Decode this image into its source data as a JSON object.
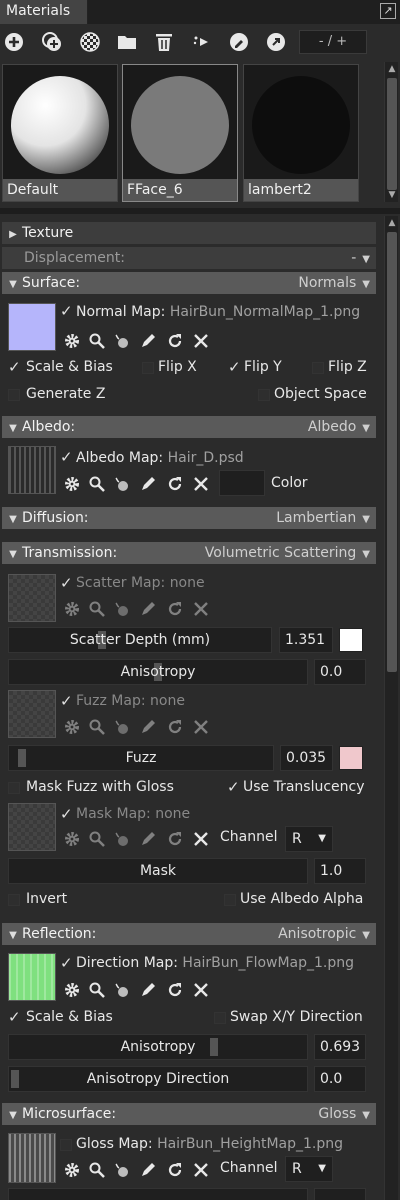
{
  "panel": {
    "tab_label": "Materials",
    "pager_text": "- / +"
  },
  "toolbar": {
    "icons": [
      "add-material-icon",
      "duplicate-material-icon",
      "checker-material-icon",
      "folder-icon",
      "delete-icon",
      "select-object-icon",
      "eyedropper-circle-icon",
      "refresh-arrow-icon"
    ]
  },
  "swatches": [
    {
      "label": "Default"
    },
    {
      "label": "FFace_6"
    },
    {
      "label": "lambert2"
    }
  ],
  "sections": {
    "texture": "Texture",
    "displacement": {
      "label": "Displacement:",
      "value": "-"
    },
    "surface": {
      "label": "Surface:",
      "value": "Normals"
    },
    "albedo": {
      "label": "Albedo:",
      "value": "Albedo"
    },
    "diffusion": {
      "label": "Diffusion:",
      "value": "Lambertian"
    },
    "transmission": {
      "label": "Transmission:",
      "value": "Volumetric Scattering"
    },
    "reflection": {
      "label": "Reflection:",
      "value": "Anisotropic"
    },
    "microsurface": {
      "label": "Microsurface:",
      "value": "Gloss"
    }
  },
  "surface": {
    "map_label": "Normal Map:",
    "map_value": "HairBun_NormalMap_1.png",
    "scale_bias": "Scale & Bias",
    "flip_x": "Flip X",
    "flip_y": "Flip Y",
    "flip_z": "Flip Z",
    "generate_z": "Generate Z",
    "object_space": "Object Space",
    "thumb_color": "#b5b5fb"
  },
  "albedo": {
    "map_label": "Albedo Map:",
    "map_value": "Hair_D.psd",
    "color_label": "Color"
  },
  "transmission": {
    "scatter_map_label": "Scatter Map:",
    "scatter_map_value": "none",
    "scatter_depth_label": "Scatter Depth (mm)",
    "scatter_depth_value": "1.351",
    "scatter_depth_fraction": 0.35,
    "anisotropy_label": "Anisotropy",
    "anisotropy_value": "0.0",
    "anisotropy_fraction": 0.5,
    "fuzz_map_label": "Fuzz Map:",
    "fuzz_map_value": "none",
    "fuzz_label": "Fuzz",
    "fuzz_value": "0.035",
    "fuzz_fraction": 0.035,
    "mask_fuzz": "Mask Fuzz with Gloss",
    "use_translucency": "Use Translucency",
    "mask_map_label": "Mask Map:",
    "mask_map_value": "none",
    "channel_label": "Channel",
    "channel_value": "R",
    "mask_label": "Mask",
    "mask_value": "1.0",
    "invert": "Invert",
    "use_albedo_alpha": "Use Albedo Alpha",
    "scatter_color": "#ffffff",
    "fuzz_color": "#f0c8cc"
  },
  "reflection": {
    "map_label": "Direction Map:",
    "map_value": "HairBun_FlowMap_1.png",
    "scale_bias": "Scale & Bias",
    "swap_xy": "Swap X/Y Direction",
    "anisotropy_label": "Anisotropy",
    "anisotropy_value": "0.693",
    "anisotropy_fraction": 0.693,
    "aniso_dir_label": "Anisotropy Direction",
    "aniso_dir_value": "0.0",
    "aniso_dir_fraction": 0.0,
    "thumb_color": "#7fe07f"
  },
  "microsurface": {
    "map_label": "Gloss Map:",
    "map_value": "HairBun_HeightMap_1.png",
    "channel_label": "Channel",
    "channel_value": "R"
  }
}
